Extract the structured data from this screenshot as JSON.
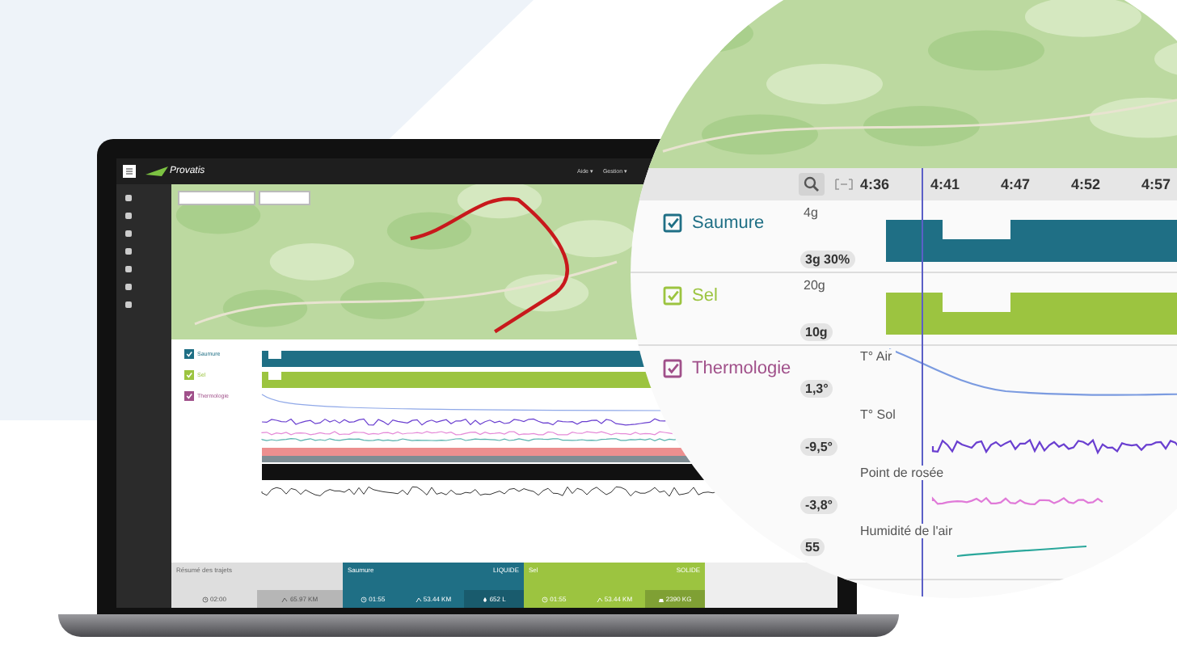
{
  "laptop_app": {
    "brand": "Provatis",
    "top_menu": [
      "Aide ▾",
      "Gestion ▾"
    ],
    "channels": [
      {
        "name": "Saumure",
        "color": "#1f6f85",
        "checked": true,
        "kind": "bar"
      },
      {
        "name": "Sel",
        "color": "#9cc440",
        "checked": true,
        "kind": "bar"
      },
      {
        "name": "Thermologie",
        "color": "#a0508a",
        "checked": true,
        "kind": "lines"
      }
    ],
    "summary": {
      "title": "Résumé des trajets",
      "stats": [
        {
          "kind": "clock",
          "text": "02:00"
        },
        {
          "kind": "route",
          "text": "65.97 KM"
        }
      ]
    },
    "summary_groups": [
      {
        "name": "Saumure",
        "type": "LIQUIDE",
        "color": "#1f6f85",
        "stats": [
          {
            "kind": "clock",
            "text": "01:55"
          },
          {
            "kind": "route",
            "text": "53.44 KM"
          },
          {
            "kind": "drop",
            "text": "652 L"
          }
        ]
      },
      {
        "name": "Sel",
        "type": "SOLIDE",
        "color": "#9cc440",
        "stats": [
          {
            "kind": "clock",
            "text": "01:55"
          },
          {
            "kind": "route",
            "text": "53.44 KM"
          },
          {
            "kind": "weight",
            "text": "2390 KG"
          }
        ]
      }
    ]
  },
  "magnifier": {
    "time_ticks": [
      "4:36",
      "4:41",
      "4:47",
      "4:52",
      "4:57"
    ],
    "channels": [
      {
        "name": "Saumure",
        "color": "#1f6f85",
        "checked": true,
        "kind": "bar",
        "max_label": "4g",
        "badge": "3g 30%"
      },
      {
        "name": "Sel",
        "color": "#9cc440",
        "checked": true,
        "kind": "bar",
        "max_label": "20g",
        "badge": "10g"
      },
      {
        "name": "Thermologie",
        "color": "#a0508a",
        "checked": true,
        "kind": "lines",
        "series": [
          {
            "label": "T° Air",
            "badge": "1,3°",
            "color": "#7b9be0"
          },
          {
            "label": "T° Sol",
            "badge": "-9,5°",
            "color": "#6a3fd0"
          },
          {
            "label": "Point de rosée",
            "badge": "-3,8°",
            "color": "#e07ad8"
          },
          {
            "label": "Humidité de l'air",
            "badge": "55",
            "color": "#2aa79b"
          }
        ]
      }
    ]
  }
}
